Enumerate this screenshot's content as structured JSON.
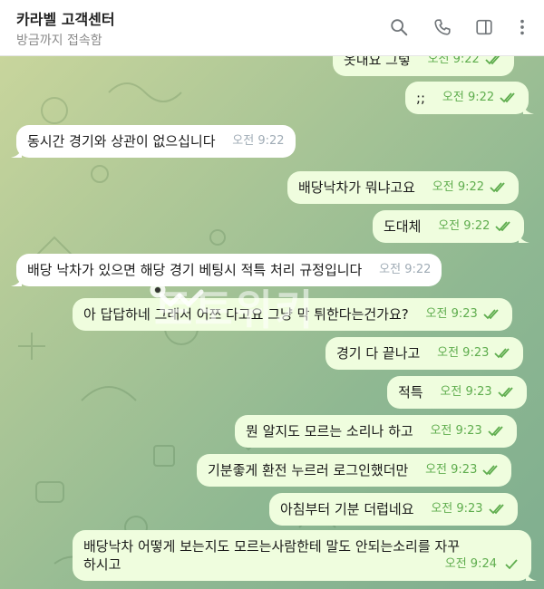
{
  "header": {
    "title": "카라벨 고객센터",
    "status": "방금까지 접속함",
    "icons": [
      "search-icon",
      "phone-icon",
      "sidebar-toggle-icon",
      "more-vertical-icon"
    ]
  },
  "messages": [
    {
      "dir": "out",
      "text": "옷내요 그렇",
      "time": "오전 9:22",
      "ticks": "double"
    },
    {
      "dir": "out",
      "text": ";;",
      "time": "오전 9:22",
      "ticks": "double"
    },
    {
      "dir": "in",
      "text": "동시간 경기와 상관이 없으십니다",
      "time": "오전 9:22"
    },
    {
      "dir": "out",
      "text": "배당낙차가 뭐냐고요",
      "time": "오전 9:22",
      "ticks": "double"
    },
    {
      "dir": "out",
      "text": "도대체",
      "time": "오전 9:22",
      "ticks": "double"
    },
    {
      "dir": "in",
      "text": "배당 낙차가 있으면 해당 경기 베팅시 적특 처리 규정입니다",
      "time": "오전 9:22"
    },
    {
      "dir": "out",
      "text": "아 답답하네 그래서 어쯔 다고요 그냥 막 튀한다는건가요?",
      "time": "오전 9:23",
      "ticks": "double"
    },
    {
      "dir": "out",
      "text": "경기 다 끝나고",
      "time": "오전 9:23",
      "ticks": "double"
    },
    {
      "dir": "out",
      "text": "적특",
      "time": "오전 9:23",
      "ticks": "double"
    },
    {
      "dir": "out",
      "text": "뭔 알지도 모르는 소리나 하고",
      "time": "오전 9:23",
      "ticks": "double"
    },
    {
      "dir": "out",
      "text": "기분좋게 환전 누르러 로그인했더만",
      "time": "오전 9:23",
      "ticks": "double"
    },
    {
      "dir": "out",
      "text": "아침부터 기분 더럽네요",
      "time": "오전 9:23",
      "ticks": "double"
    },
    {
      "dir": "out",
      "text_line1": "배당낙차 어떻게 보는지도 모르는사람한테 말도 안되는소리를 자꾸",
      "text_line2": "하시고",
      "time": "오전 9:24",
      "ticks": "single"
    }
  ],
  "watermark": {
    "text": "토토위키"
  },
  "colors": {
    "outgoing_bubble": "#effdde",
    "incoming_bubble": "#ffffff",
    "tick_green": "#5fad4e"
  }
}
